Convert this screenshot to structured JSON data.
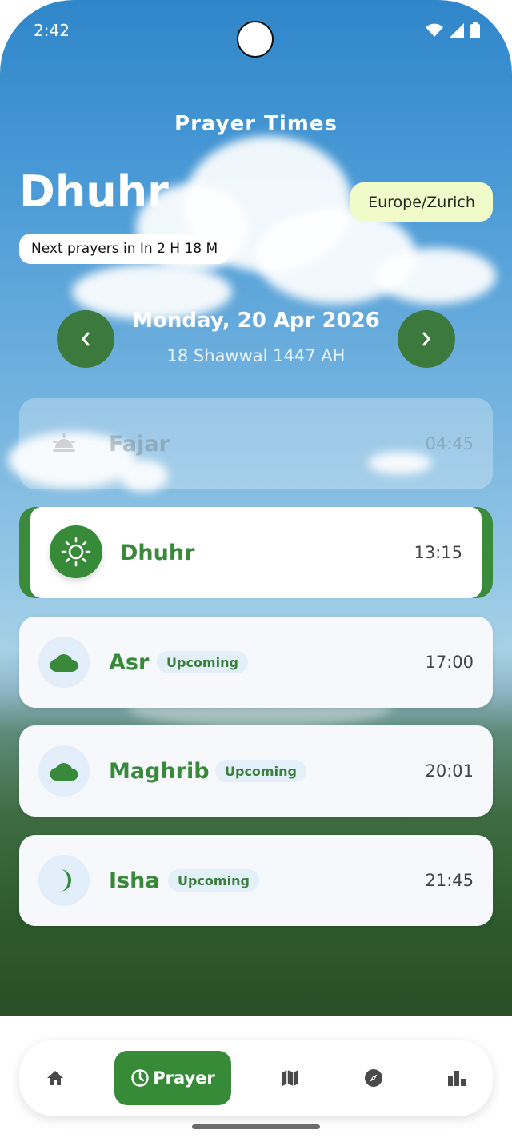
{
  "status_bar": {
    "time": "2:42"
  },
  "header": {
    "title": "Prayer Times",
    "current_prayer": "Dhuhr",
    "timezone": "Europe/Zurich",
    "next_prayer_text": "Next prayers in In 2 H 18 M"
  },
  "date_nav": {
    "gregorian": "Monday, 20 Apr 2026",
    "hijri": "18 Shawwal 1447 AH"
  },
  "prayers": [
    {
      "name": "Fajar",
      "time": "04:45",
      "state": "past",
      "icon": "sunrise-icon"
    },
    {
      "name": "Dhuhr",
      "time": "13:15",
      "state": "current",
      "icon": "sun-icon"
    },
    {
      "name": "Asr",
      "time": "17:00",
      "state": "upcoming",
      "badge": "Upcoming",
      "icon": "cloud-icon"
    },
    {
      "name": "Maghrib",
      "time": "20:01",
      "state": "upcoming",
      "badge": "Upcoming",
      "icon": "cloud-icon"
    },
    {
      "name": "Isha",
      "time": "21:45",
      "state": "upcoming",
      "badge": "Upcoming",
      "icon": "moon-icon"
    }
  ],
  "bottom_nav": {
    "items": [
      {
        "icon": "home-icon"
      },
      {
        "label": "Prayer",
        "icon": "clock-icon",
        "active": true
      },
      {
        "icon": "map-icon"
      },
      {
        "icon": "compass-icon"
      },
      {
        "icon": "bar-chart-icon"
      }
    ]
  },
  "colors": {
    "accent": "#368a38",
    "timezone_badge": "#f0fbc9",
    "badge_bg": "#e3eff9"
  }
}
